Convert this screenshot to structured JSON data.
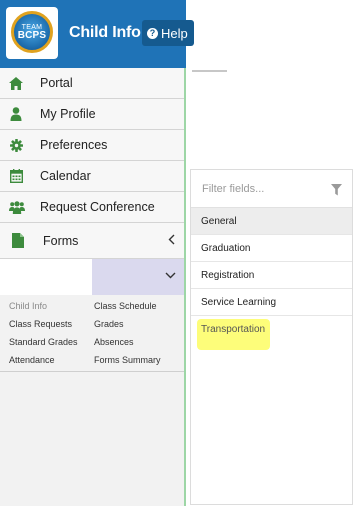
{
  "header": {
    "logo_line1": "TEAM",
    "logo_line2": "BCPS",
    "title": "Child Info",
    "help_label": "Help"
  },
  "sidebar": {
    "items": [
      {
        "label": "Portal",
        "icon": "home-icon"
      },
      {
        "label": "My Profile",
        "icon": "user-icon"
      },
      {
        "label": "Preferences",
        "icon": "gear-icon"
      },
      {
        "label": "Calendar",
        "icon": "calendar-icon"
      },
      {
        "label": "Request Conference",
        "icon": "users-icon"
      },
      {
        "label": "Forms",
        "icon": "file-icon"
      }
    ],
    "sublinks": {
      "col1": [
        "Child Info",
        "Class Requests",
        "Standard Grades",
        "Attendance"
      ],
      "col2": [
        "Class Schedule",
        "Grades",
        "Absences",
        "Forms Summary"
      ]
    }
  },
  "filter": {
    "placeholder": "Filter fields...",
    "items": [
      "General",
      "Graduation",
      "Registration",
      "Service Learning",
      "Transportation"
    ],
    "selected": "General",
    "highlighted": "Transportation"
  },
  "colors": {
    "header_blue": "#1f73b7",
    "icon_green": "#3d8b3d",
    "highlight_yellow": "#fdfd7a"
  }
}
